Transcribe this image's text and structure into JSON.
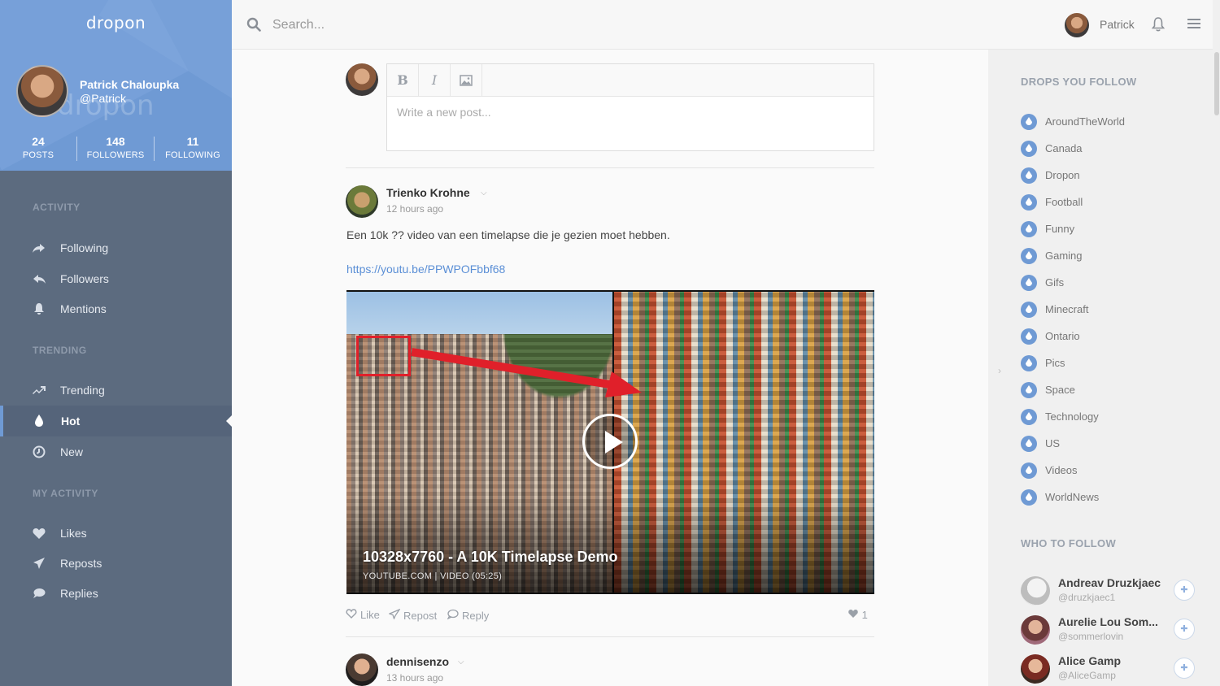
{
  "app": {
    "logo": "dropon",
    "watermark": "dropon"
  },
  "profile": {
    "name": "Patrick Chaloupka",
    "handle": "@Patrick",
    "stats": [
      {
        "num": "24",
        "label": "POSTS"
      },
      {
        "num": "148",
        "label": "FOLLOWERS"
      },
      {
        "num": "11",
        "label": "FOLLOWING"
      }
    ]
  },
  "nav": {
    "activity_head": "ACTIVITY",
    "activity": [
      {
        "label": "Following",
        "icon": "share-icon"
      },
      {
        "label": "Followers",
        "icon": "reply-icon"
      },
      {
        "label": "Mentions",
        "icon": "bell-icon"
      }
    ],
    "trending_head": "TRENDING",
    "trending": [
      {
        "label": "Trending",
        "icon": "trending-icon"
      },
      {
        "label": "Hot",
        "icon": "drop-icon",
        "active": true
      },
      {
        "label": "New",
        "icon": "clock-icon"
      }
    ],
    "myactivity_head": "MY ACTIVITY",
    "myactivity": [
      {
        "label": "Likes",
        "icon": "heart-icon"
      },
      {
        "label": "Reposts",
        "icon": "paper-plane-icon"
      },
      {
        "label": "Replies",
        "icon": "chat-bubble-icon"
      }
    ]
  },
  "topbar": {
    "search_placeholder": "Search...",
    "username": "Patrick"
  },
  "composer": {
    "placeholder": "Write a new post...",
    "bold": "B",
    "italic": "I"
  },
  "posts": [
    {
      "author": "Trienko Krohne",
      "time": "12 hours ago",
      "text": "Een 10k ?? video van een timelapse die je gezien moet hebben.",
      "link": "https://youtu.be/PPWPOFbbf68",
      "media_title": "10328x7760 - A 10K Timelapse Demo",
      "media_sub": "YOUTUBE.COM | VIDEO (05:25)",
      "actions": {
        "like": "Like",
        "repost": "Repost",
        "reply": "Reply"
      },
      "like_count": "1"
    },
    {
      "author": "dennisenzo",
      "time": "13 hours ago"
    }
  ],
  "right": {
    "drops_head": "DROPS YOU FOLLOW",
    "drops": [
      "AroundTheWorld",
      "Canada",
      "Dropon",
      "Football",
      "Funny",
      "Gaming",
      "Gifs",
      "Minecraft",
      "Ontario",
      "Pics",
      "Space",
      "Technology",
      "US",
      "Videos",
      "WorldNews"
    ],
    "who_head": "WHO TO FOLLOW",
    "who": [
      {
        "name": "Andreav Druzkjaec",
        "handle": "@druzkjaec1"
      },
      {
        "name": "Aurelie Lou Som...",
        "handle": "@sommerlovin"
      },
      {
        "name": "Alice Gamp",
        "handle": "@AliceGamp"
      }
    ]
  },
  "colors": {
    "accent": "#6f9ad4",
    "sidebar": "#5c6b7f",
    "link": "#5b8fd6"
  }
}
